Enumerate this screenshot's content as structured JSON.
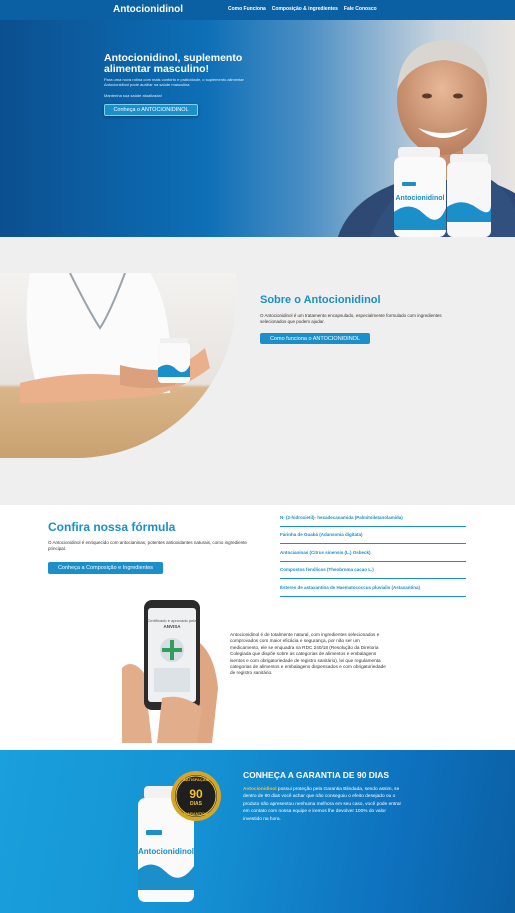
{
  "nav": {
    "logo": "Antocionidinol",
    "menu": [
      "Como Funciona",
      "Composição & ingredientes",
      "Fale Conosco"
    ]
  },
  "hero": {
    "title": "Antocionidinol, suplemento alimentar masculino!",
    "text": "Para uma nova rotina com mais conforto e praticidade, o suplemento alimentar Antocionidinol pode auxiliar na saúde masculina.",
    "text2": "Mantenha sua saúde atualizada!",
    "button": "Conheça o ANTOCIONIDINOL",
    "product_label": "Antocionidinol"
  },
  "sobre": {
    "title": "Sobre o Antocionidinol",
    "text": "O Antocionidinol é um tratamento encapsulado, especialmente formulado com ingredientes selecionados que podem ajudar.",
    "button": "Como funciona o ANTOCIONIDINOL"
  },
  "formula": {
    "title": "Confira nossa fórmula",
    "text": "O Antocionidinol é enriquecido com antocianinas, potentes antioxidantes naturais, como ingrediente principal.",
    "button": "Conheça a Composição e Ingredientes",
    "ingredients": [
      "N- (2-hidroxietil)- hexadecanamida (Palmitoiletanolamida)",
      "Farinha de Guabá (Adansonia digitata)",
      "Antocianinas (Citrus sinensis (L.) Osbeck)",
      "Compostos fenólicos (Theobroma cacao L.)",
      "Ésteres de astaxantina de Haematococcus pluvialis (Astaxantina)"
    ]
  },
  "natural": {
    "phone_screen": "Certificado e aprovado pela ANVISA",
    "text": "Antocionidinol é de totalmente natural, com ingredientes selecionados e comprovados com maior eficácia e segurança, por não ser um medicamento, ele se enquadra na RDC 240/18 (Resolução da Diretoria Colegiada que dispõe sobre as categorias de alimentos e embalagens isentos e com obrigatoriedade de registro sanitário), lei que regulamenta categorias de alimentos e embalagens dispensados e com obrigatoriedade de registro sanitário."
  },
  "garantia": {
    "title": "CONHEÇA A GARANTIA DE 90 DIAS",
    "brand": "Antocionidinol",
    "text": " possui proteção pela Garantia Blindada, sendo assim, se dentro de 90 dias você achar que não conseguiu o efeito desejado ou o produto não apresentou nenhuma melhora em seu caso, você pode entrar em contato com nossa equipe e iremos lhe devolver 100% do valor investido na hora.",
    "seal_top": "SATISFAÇÃO",
    "seal_number": "90",
    "seal_days": "DIAS",
    "seal_bottom": "GARANTIDA",
    "product_label": "Antocionidinol"
  },
  "colors": {
    "accent": "#1a8fc9",
    "nav": "#0b5fa3",
    "gold": "#f3c233"
  }
}
